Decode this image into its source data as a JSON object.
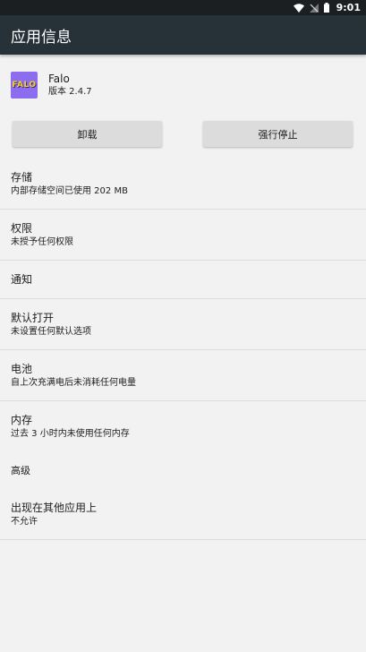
{
  "status_bar": {
    "time": "9:01",
    "icons": [
      "wifi-icon",
      "no-signal-icon",
      "battery-icon"
    ]
  },
  "app_bar": {
    "title": "应用信息"
  },
  "app": {
    "icon_label": "FALO",
    "name": "Falo",
    "version": "版本 2.4.7"
  },
  "buttons": {
    "uninstall": "卸载",
    "force_stop": "强行停止"
  },
  "settings": [
    {
      "id": "storage",
      "title": "存储",
      "summary": "内部存储空间已使用 202 MB"
    },
    {
      "id": "permissions",
      "title": "权限",
      "summary": "未授予任何权限"
    },
    {
      "id": "notifications",
      "title": "通知",
      "summary": ""
    },
    {
      "id": "open-by-default",
      "title": "默认打开",
      "summary": "未设置任何默认选项"
    },
    {
      "id": "battery",
      "title": "电池",
      "summary": "自上次充满电后未消耗任何电量"
    },
    {
      "id": "memory",
      "title": "内存",
      "summary": "过去 3 小时内未使用任何内存"
    }
  ],
  "advanced": {
    "label": "高级",
    "items": [
      {
        "id": "draw-over-other-apps",
        "title": "出现在其他应用上",
        "summary": "不允许"
      }
    ]
  },
  "colors": {
    "status_bar": "#1b1f22",
    "app_bar": "#263238",
    "background": "#f2f2f2",
    "button": "#dcdcdc",
    "app_icon_bg": "#8c6df0",
    "app_icon_text": "#f7d21c"
  }
}
